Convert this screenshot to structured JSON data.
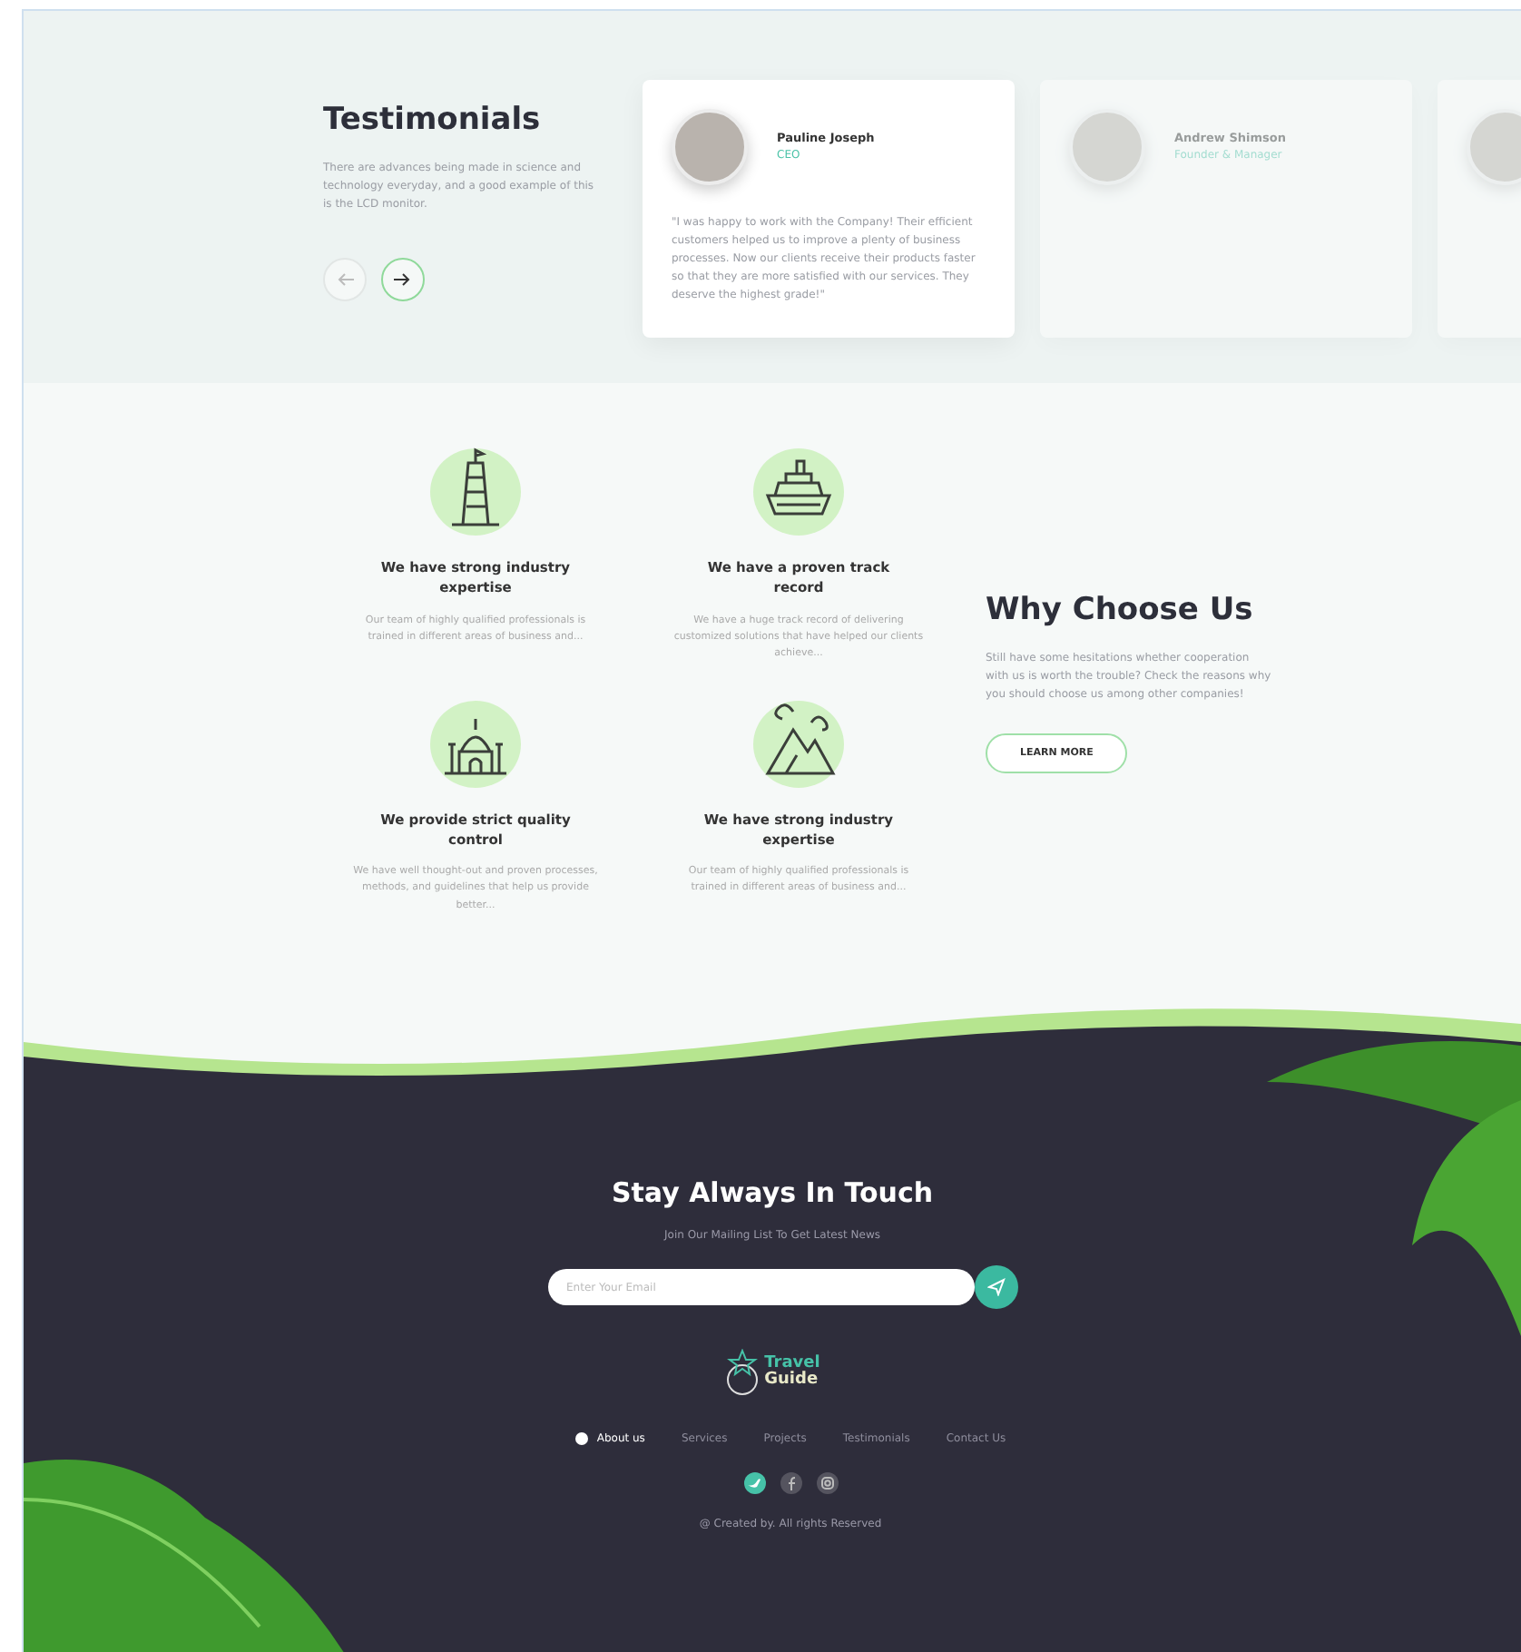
{
  "testimonials": {
    "title": "Testimonials",
    "text": "There are advances being made in science and technology everyday, and a good example of this is the LCD monitor.",
    "nav": [
      {
        "kind": "left",
        "selected": false
      },
      {
        "kind": "right",
        "selected": true
      }
    ],
    "cards": [
      {
        "name": "Pauline Joseph",
        "role": "CEO",
        "quote": "\"I was happy to work with the Company! Their efficient customers helped us to improve a plenty of business processes. Now our clients receive their products faster so that they are more satisfied with our services. They deserve the highest grade!\"",
        "faded": false
      },
      {
        "name": "Andrew Shimson",
        "role": "Founder & Manager",
        "faded": true
      },
      {
        "faded": true
      }
    ]
  },
  "features": [
    {
      "kind": "tower",
      "title": "We have strong industry expertise",
      "text": "Our team of highly qualified professionals is trained in different areas of business and..."
    },
    {
      "kind": "ship",
      "title": "We have a proven track record",
      "text": "We have a huge track record of delivering customized solutions that have helped our clients achieve..."
    },
    {
      "kind": "palace",
      "title": "We provide strict quality control",
      "text": "We have well thought-out and proven processes, methods, and guidelines that help us provide better..."
    },
    {
      "kind": "mountain",
      "title": "We have strong industry expertise",
      "text": "Our team of highly qualified professionals is trained in different areas of business and..."
    }
  ],
  "why": {
    "title": "Why Choose Us",
    "text": "Still have some hesitations whether cooperation with us is worth the trouble? Check the reasons why you should choose us among other companies!",
    "button": "LEARN MORE"
  },
  "newsletter": {
    "title": "Stay Always In Touch",
    "subtitle": "Join Our Mailing List To Get Latest News",
    "placeholder": "Enter Your Email"
  },
  "footer": {
    "logo_top": "Travel",
    "logo_bottom": "Guide",
    "nav": [
      {
        "label": "About us",
        "selected": true
      },
      {
        "label": "Services",
        "selected": false
      },
      {
        "label": "Projects",
        "selected": false
      },
      {
        "label": "Testimonials",
        "selected": false
      },
      {
        "label": "Contact Us",
        "selected": false
      }
    ],
    "social": [
      {
        "kind": "twitter",
        "selected": true
      },
      {
        "kind": "facebook",
        "selected": false
      },
      {
        "kind": "instagram",
        "selected": false
      }
    ],
    "copyright": "@ Created by. All rights Reserved"
  }
}
